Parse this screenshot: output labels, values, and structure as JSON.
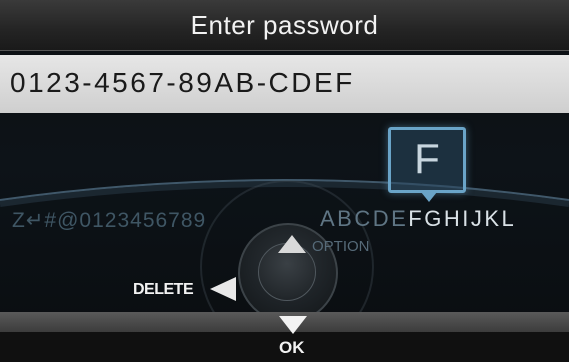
{
  "header": {
    "title": "Enter password"
  },
  "input": {
    "value": "0123-4567-89AB-CDEF"
  },
  "keyboard": {
    "chars_dim": "Z↵#@0123456789",
    "chars_right_dim": "ABCDE",
    "chars_selected": "F",
    "chars_right_bright": "GHIJKL",
    "selected_char": "F",
    "option_label": "OPTION"
  },
  "controls": {
    "delete_label": "DELETE",
    "ok_label": "OK"
  },
  "colors": {
    "popup_border": "#6aa4c8",
    "text": "#f2f2f2",
    "input_bg": "#d9d9d9"
  }
}
